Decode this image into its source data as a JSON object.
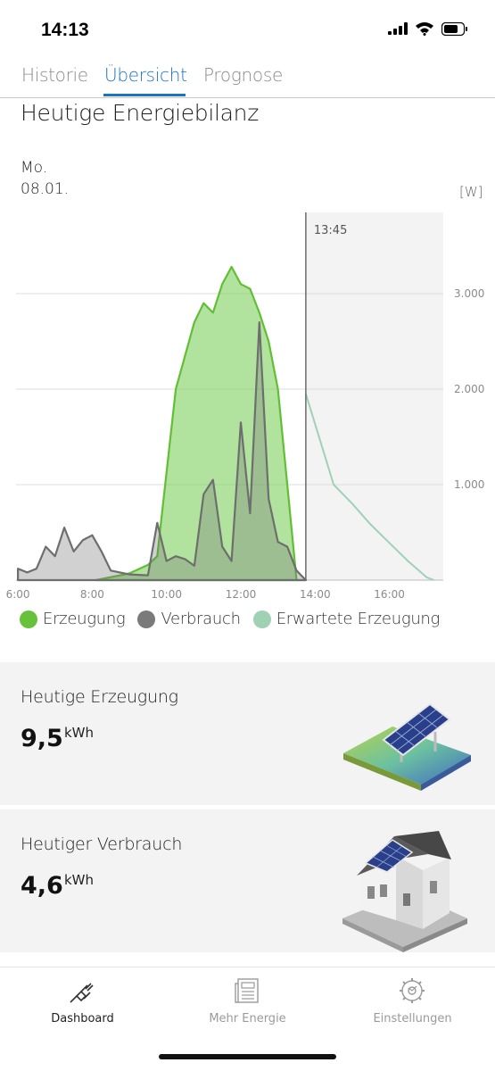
{
  "status_bar": {
    "time": "14:13"
  },
  "tabs": [
    {
      "label": "Historie",
      "active": false
    },
    {
      "label": "Übersicht",
      "active": true
    },
    {
      "label": "Prognose",
      "active": false
    }
  ],
  "section_title": "Heutige Energiebilanz",
  "day": "Mo.",
  "date": "08.01.",
  "unit": "[W]",
  "now_marker": "13:45",
  "colors": {
    "accent": "#1a73c8",
    "erzeugung": "#66c23a",
    "verbrauch": "#7a7a7a",
    "erwartete": "#9fd1b5"
  },
  "chart_data": {
    "type": "area",
    "xlabel": "",
    "ylabel": "[W]",
    "x_ticks": [
      "6:00",
      "8:00",
      "10:00",
      "12:00",
      "14:00",
      "16:00"
    ],
    "y_ticks": [
      "1.000",
      "2.000",
      "3.000"
    ],
    "ylim": [
      0,
      3850
    ],
    "xlim_hours": [
      5.95,
      17.45
    ],
    "marker_time": "13:45",
    "series": [
      {
        "name": "Erzeugung",
        "x": [
          8.1,
          9.0,
          9.5,
          9.75,
          10.25,
          10.75,
          11.0,
          11.25,
          11.5,
          11.75,
          12.0,
          12.25,
          12.5,
          12.75,
          13.0,
          13.25,
          13.5,
          13.75
        ],
        "y": [
          0,
          70,
          160,
          250,
          2000,
          2700,
          2900,
          2800,
          3100,
          3280,
          3100,
          3050,
          2800,
          2500,
          2000,
          1000,
          0,
          0
        ]
      },
      {
        "name": "Verbrauch",
        "x": [
          6.0,
          6.25,
          6.5,
          6.75,
          7.0,
          7.25,
          7.5,
          7.75,
          8.0,
          8.25,
          8.5,
          9.0,
          9.5,
          9.75,
          10.0,
          10.25,
          10.5,
          10.75,
          11.0,
          11.25,
          11.5,
          11.75,
          12.0,
          12.25,
          12.5,
          12.75,
          13.0,
          13.25,
          13.5,
          13.75
        ],
        "y": [
          120,
          80,
          120,
          350,
          250,
          550,
          300,
          420,
          470,
          300,
          100,
          60,
          50,
          600,
          200,
          250,
          220,
          150,
          900,
          1050,
          350,
          200,
          1650,
          700,
          2700,
          850,
          400,
          350,
          100,
          0
        ]
      },
      {
        "name": "Erwartete Erzeugung",
        "x": [
          13.75,
          14.5,
          15.0,
          15.5,
          16.0,
          16.5,
          17.0,
          17.2
        ],
        "y": [
          1950,
          1000,
          800,
          580,
          390,
          200,
          30,
          0
        ]
      }
    ]
  },
  "legend": [
    {
      "label": "Erzeugung",
      "color": "#66c23a"
    },
    {
      "label": "Verbrauch",
      "color": "#7a7a7a"
    },
    {
      "label": "Erwartete Erzeugung",
      "color": "#9fd1b5"
    }
  ],
  "cards": [
    {
      "title": "Heutige Erzeugung",
      "value": "9,5",
      "unit": "kWh"
    },
    {
      "title": "Heutiger Verbrauch",
      "value": "4,6",
      "unit": "kWh"
    }
  ],
  "bottom_nav": [
    {
      "label": "Dashboard",
      "icon": "plug-icon",
      "active": true
    },
    {
      "label": "Mehr Energie",
      "icon": "newspaper-icon",
      "active": false
    },
    {
      "label": "Einstellungen",
      "icon": "gear-icon",
      "active": false
    }
  ]
}
